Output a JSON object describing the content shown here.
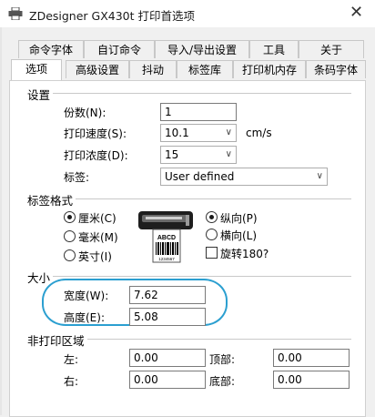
{
  "window": {
    "title": "ZDesigner GX430t 打印首选项",
    "close_glyph": "✕"
  },
  "tabs_back": [
    "命令字体",
    "自订命令",
    "导入/导出设置",
    "工具",
    "关于"
  ],
  "tabs_front": [
    "选项",
    "高级设置",
    "抖动",
    "标签库",
    "打印机内存",
    "条码字体"
  ],
  "active_tab": "选项",
  "settings": {
    "group_label": "设置",
    "copies_label": "份数(N):",
    "copies_value": "1",
    "speed_label": "打印速度(S):",
    "speed_value": "10.1",
    "speed_unit": "cm/s",
    "darkness_label": "打印浓度(D):",
    "darkness_value": "15",
    "label_label": "标签:",
    "label_value": "User defined"
  },
  "label_format": {
    "group_label": "标签格式",
    "units": [
      "厘米(C)",
      "毫米(M)",
      "英寸(I)"
    ],
    "selected_unit": "厘米(C)",
    "orientation": [
      "纵向(P)",
      "横向(L)"
    ],
    "selected_orientation": "纵向(P)",
    "rotate_label": "旋转180?",
    "rotate_checked": false,
    "printer_label_text": "ABCD",
    "printer_label_number": "1234567"
  },
  "size": {
    "group_label": "大小",
    "width_label": "宽度(W):",
    "width_value": "7.62",
    "height_label": "高度(E):",
    "height_value": "5.08",
    "highlight_color": "#2b9fd0"
  },
  "nonprint": {
    "group_label": "非打印区域",
    "left_label": "左:",
    "left_value": "0.00",
    "top_label": "顶部:",
    "top_value": "0.00",
    "right_label": "右:",
    "right_value": "0.00",
    "bottom_label": "底部:",
    "bottom_value": "0.00"
  }
}
